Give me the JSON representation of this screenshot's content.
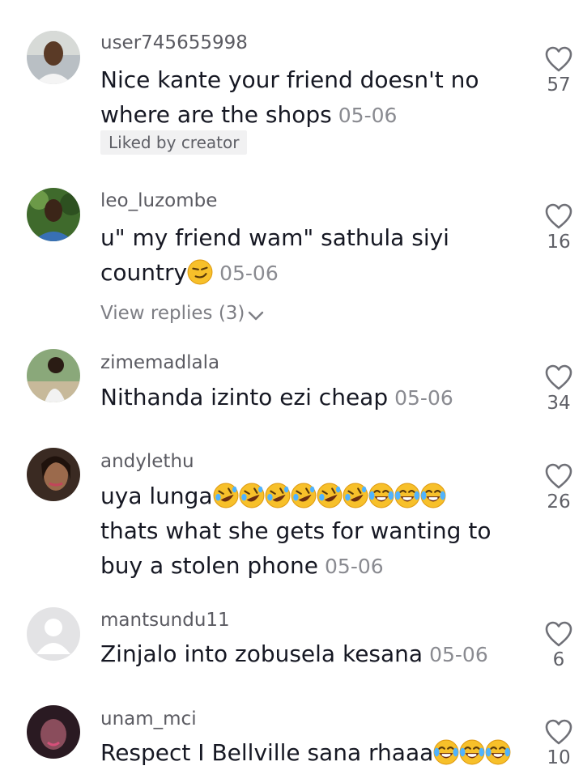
{
  "comments": [
    {
      "username": "user745655998",
      "line1": "Nice kante your friend doesn't no",
      "line2": "where are the shops",
      "date": "05-06",
      "badge": "Liked by creator",
      "likes": "57"
    },
    {
      "username": "leo_luzombe",
      "line1": "u\" my friend wam\" sathula siyi",
      "line2": "country",
      "date": "05-06",
      "replies": "View replies (3)",
      "likes": "16"
    },
    {
      "username": "zimemadlala",
      "line1": "Nithanda izinto ezi cheap",
      "date": "05-06",
      "likes": "34"
    },
    {
      "username": "andylethu",
      "line1": "uya lunga",
      "line2": "thats what she gets for wanting to",
      "line3": "buy a stolen phone",
      "date": "05-06",
      "likes": "26"
    },
    {
      "username": "mantsundu11",
      "line1": "Zinjalo into zobusela kesana",
      "date": "05-06",
      "likes": "6"
    },
    {
      "username": "unam_mci",
      "line1": "Respect I Bellville sana rhaaa",
      "likes": "10"
    }
  ],
  "icons": {
    "like": "heart-outline-icon",
    "emoji_smirk": "smirk-emoji",
    "emoji_rofl": "rolling-laughing-emoji",
    "emoji_joy": "tears-of-joy-emoji",
    "chevron": "chevron-down-icon"
  }
}
